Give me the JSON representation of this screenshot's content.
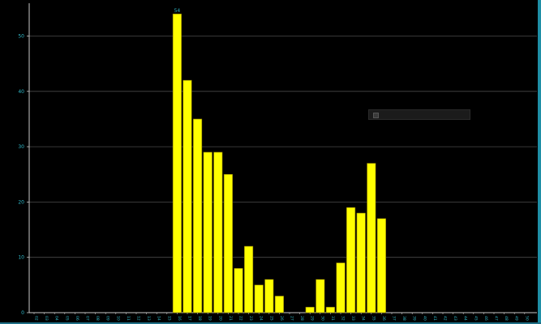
{
  "colors": {
    "background": "#000000",
    "bar_fill": "#ffff00",
    "bar_stroke": "#8a7a00",
    "grid": "#4a4a4a",
    "axis": "#c8c8c8",
    "tick_text": "#2fb8c8",
    "data_label": "#2fb8c8",
    "accent_edge": "#1f8fa6"
  },
  "legend": {
    "swatch_icon": "square-icon",
    "text": ""
  },
  "chart_data": {
    "type": "bar",
    "title": "",
    "xlabel": "",
    "ylabel": "",
    "ylim": [
      0,
      56
    ],
    "y_ticks": [
      "0",
      "10",
      "20",
      "30",
      "40",
      "50"
    ],
    "y_tick_values": [
      0,
      10,
      20,
      30,
      40,
      50
    ],
    "grid": true,
    "legend_position": "center-right",
    "categories": [
      "02",
      "03",
      "04",
      "05",
      "06",
      "07",
      "08",
      "09",
      "10",
      "11",
      "12",
      "13",
      "14",
      "15",
      "16",
      "17",
      "18",
      "19",
      "20",
      "21",
      "22",
      "23",
      "24",
      "25",
      "26",
      "27",
      "28",
      "29",
      "30",
      "31",
      "32",
      "33",
      "34",
      "35",
      "36",
      "37",
      "38",
      "39",
      "40",
      "41",
      "42",
      "43",
      "44",
      "45",
      "46",
      "47",
      "48",
      "49",
      "50"
    ],
    "values": [
      0,
      0,
      0,
      0,
      0,
      0,
      0,
      0,
      0,
      0,
      0,
      0,
      0,
      0,
      54,
      42,
      35,
      29,
      29,
      25,
      8,
      12,
      5,
      6,
      3,
      0,
      0,
      1,
      6,
      1,
      9,
      19,
      18,
      27,
      17,
      0,
      0,
      0,
      0,
      0,
      0,
      0,
      0,
      0,
      0,
      0,
      0,
      0,
      0
    ],
    "data_labels": [
      {
        "index": 14,
        "text": "54"
      }
    ]
  }
}
